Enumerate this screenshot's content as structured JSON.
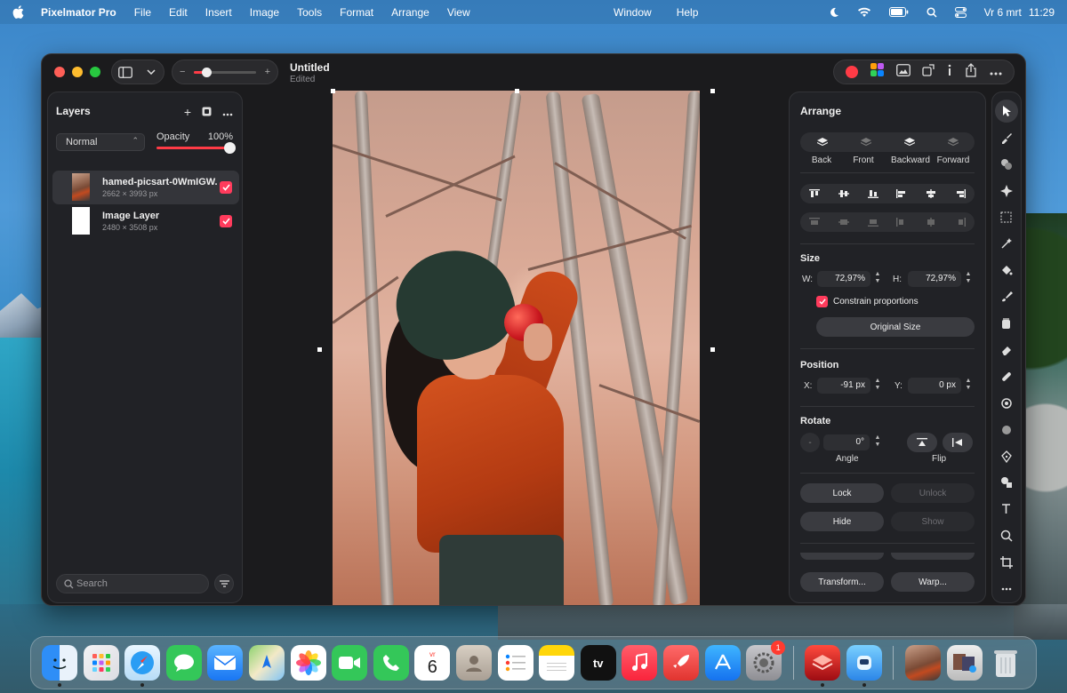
{
  "menubar": {
    "app_name": "Pixelmator Pro",
    "items": [
      "File",
      "Edit",
      "Insert",
      "Image",
      "Tools",
      "Format",
      "Arrange",
      "View"
    ],
    "center_items": [
      "Window",
      "Help"
    ],
    "date": "Vr 6 mrt",
    "time": "11:29"
  },
  "window": {
    "title": "Untitled",
    "subtitle": "Edited",
    "zoom_percent": 20
  },
  "layers": {
    "title": "Layers",
    "blend_mode": "Normal",
    "opacity_label": "Opacity",
    "opacity_value": "100%",
    "items": [
      {
        "name": "hamed-picsart-0WmIGW...",
        "size": "2662 × 3993 px",
        "visible": true,
        "selected": true
      },
      {
        "name": "Image Layer",
        "size": "2480 × 3508 px",
        "visible": true,
        "selected": false
      }
    ],
    "search_placeholder": "Search"
  },
  "arrange": {
    "title": "Arrange",
    "order_buttons": [
      "Back",
      "Front",
      "Backward",
      "Forward"
    ],
    "size": {
      "label": "Size",
      "w_label": "W:",
      "w_value": "72,97%",
      "h_label": "H:",
      "h_value": "72,97%",
      "constrain_label": "Constrain proportions",
      "original_size_button": "Original Size"
    },
    "position": {
      "label": "Position",
      "x_label": "X:",
      "x_value": "-91 px",
      "y_label": "Y:",
      "y_value": "0 px"
    },
    "rotate": {
      "label": "Rotate",
      "angle_value": "0°",
      "angle_label": "Angle",
      "flip_label": "Flip"
    },
    "lock_button": "Lock",
    "unlock_button": "Unlock",
    "hide_button": "Hide",
    "show_button": "Show",
    "transform_button": "Transform...",
    "warp_button": "Warp..."
  },
  "dock": {
    "calendar_month": "vr",
    "calendar_day": "6",
    "settings_badge": "1",
    "tv_label": "tv"
  },
  "colors": {
    "accent": "#ff3b46",
    "checkbox": "#ff3b5c"
  }
}
